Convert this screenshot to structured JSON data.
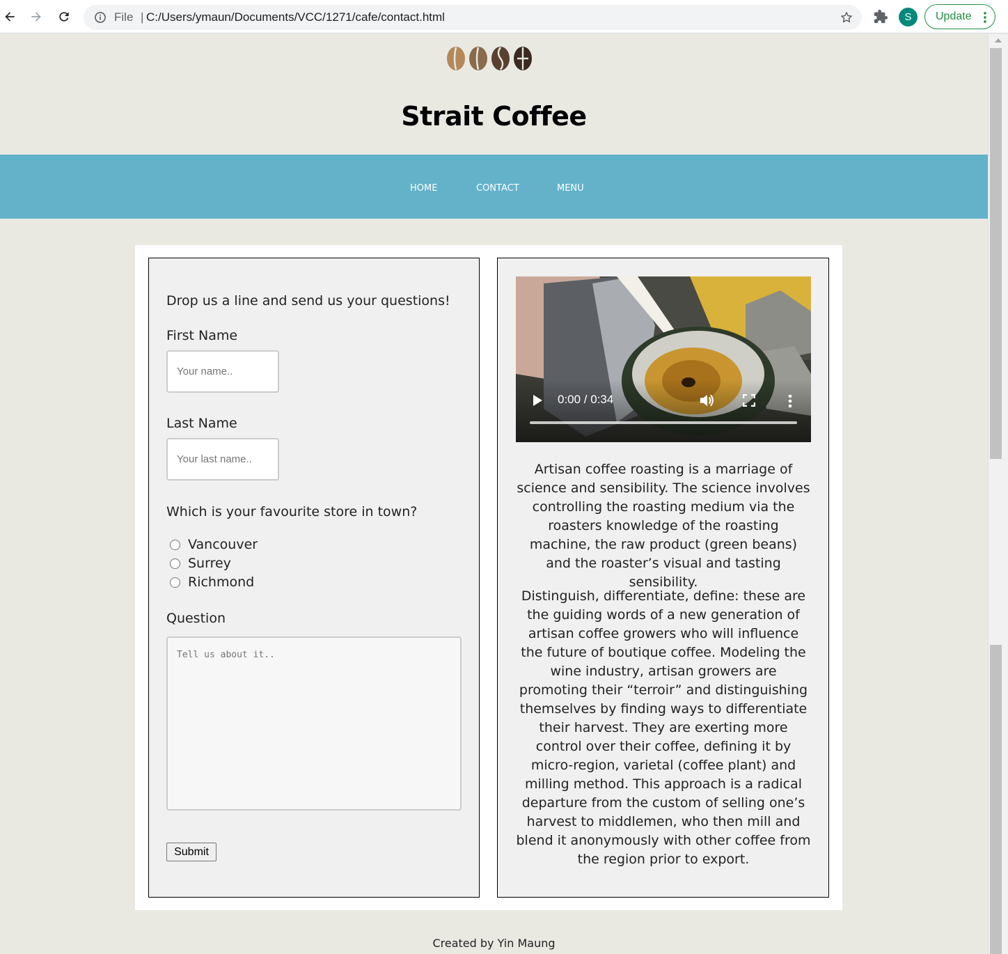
{
  "browser": {
    "file_label": "File",
    "separator": "|",
    "url": "C:/Users/ymaun/Documents/VCC/1271/cafe/contact.html",
    "avatar_letter": "S",
    "update_label": "Update"
  },
  "site": {
    "title": "Strait Coffee",
    "nav": [
      "HOME",
      "CONTACT",
      "MENU"
    ]
  },
  "form": {
    "intro": "Drop us a line and send us your questions!",
    "first_name_label": "First Name",
    "first_name_placeholder": "Your name..",
    "last_name_label": "Last Name",
    "last_name_placeholder": "Your last name..",
    "store_question": "Which is your favourite store in town?",
    "stores": [
      "Vancouver",
      "Surrey",
      "Richmond"
    ],
    "question_label": "Question",
    "question_placeholder": "Tell us about it..",
    "submit_label": "Submit"
  },
  "video": {
    "time": "0:00 / 0:34",
    "progress": 0
  },
  "content": {
    "paragraph1": "Artisan coffee roasting is a marriage of science and sensibility. The science involves controlling the roasting medium via the roasters knowledge of the roasting machine, the raw product (green beans) and the roaster’s visual and tasting sensibility.",
    "paragraph2": "Distinguish, differentiate, define: these are the guiding words of a new generation of artisan coffee growers who will influence the future of boutique coffee. Modeling the wine industry, artisan growers are promoting their “terroir” and distinguishing themselves by finding ways to differentiate their harvest. They are exerting more control over their coffee, defining it by micro-region, varietal (coffee plant) and milling method. This approach is a radical departure from the custom of selling one’s harvest to middlemen, who then mill and blend it anonymously with other coffee from the region prior to export."
  },
  "footer": {
    "text": "Created by Yin Maung"
  },
  "colors": {
    "nav_bg": "#63b2ca",
    "page_bg": "#e9e9e2",
    "update_green": "#1e8e3e",
    "avatar_teal": "#00897b"
  }
}
